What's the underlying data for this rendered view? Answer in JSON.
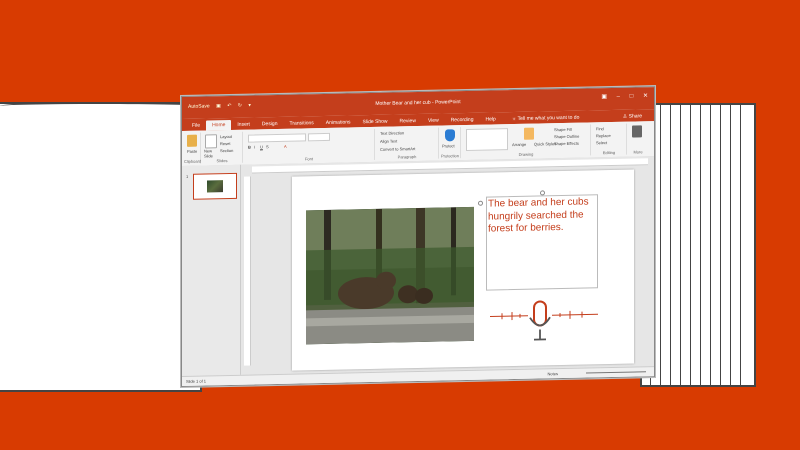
{
  "window": {
    "title": "Mother Bear and her cub - PowerPoint",
    "quick_access": [
      "AutoSave",
      "Save",
      "Undo",
      "Redo",
      "Customize"
    ],
    "controls": [
      "ribbon-options",
      "minimize",
      "maximize",
      "close"
    ]
  },
  "tabs": [
    "File",
    "Home",
    "Insert",
    "Design",
    "Transitions",
    "Animations",
    "Slide Show",
    "Review",
    "View",
    "Recording",
    "Help"
  ],
  "active_tab": "Home",
  "tell_me": "Tell me what you want to do",
  "share": "Share",
  "ribbon": {
    "clipboard": {
      "paste": "Paste",
      "label": "Clipboard"
    },
    "slides": {
      "new_slide": "New Slide",
      "layout": "Layout",
      "reset": "Reset",
      "section": "Section",
      "label": "Slides"
    },
    "font": {
      "label": "Font"
    },
    "paragraph": {
      "text_direction": "Text Direction",
      "align_text": "Align Text",
      "convert_smartart": "Convert to SmartArt",
      "label": "Paragraph"
    },
    "protection": {
      "protect": "Protect",
      "label": "Protection"
    },
    "drawing": {
      "arrange": "Arrange",
      "quick_styles": "Quick Styles",
      "shape_fill": "Shape Fill",
      "shape_outline": "Shape Outline",
      "shape_effects": "Shape Effects",
      "label": "Drawing"
    },
    "editing": {
      "find": "Find",
      "replace": "Replace",
      "select": "Select",
      "label": "Editing"
    },
    "more": {
      "label": "More"
    }
  },
  "thumbnail": {
    "number": "1"
  },
  "slide": {
    "text": "The bear and her cubs hungrily searched the forest for berries."
  },
  "status": {
    "slide_count": "Slide 1 of 1",
    "notes": "Notes"
  },
  "colors": {
    "background": "#d83b01",
    "accent": "#c43e1c"
  }
}
